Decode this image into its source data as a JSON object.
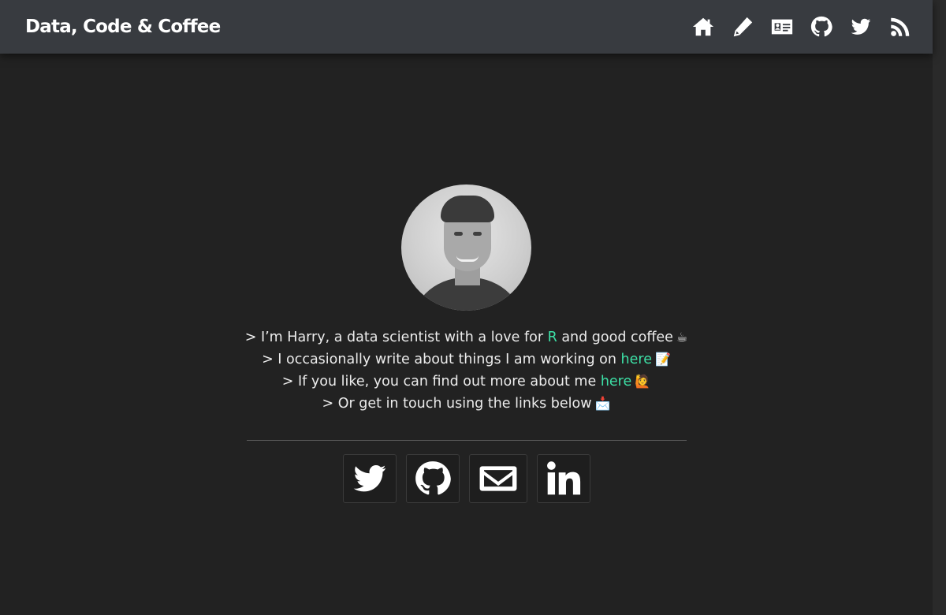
{
  "navbar": {
    "brand": "Data, Code & Coffee",
    "icons": [
      "home-icon",
      "pencil-icon",
      "id-card-icon",
      "github-icon",
      "twitter-icon",
      "rss-icon"
    ]
  },
  "bio": {
    "line1_pre": "> I’m Harry, a data scientist with a love for ",
    "line1_link": "R",
    "line1_post": " and good coffee",
    "line1_emoji": "☕",
    "line2_pre": "> I occasionally write about things I am working on ",
    "line2_link": "here",
    "line2_emoji": "📝",
    "line3_pre": "> If you like, you can find out more about me ",
    "line3_link": "here",
    "line3_emoji": "🙋",
    "line4_pre": "> Or get in touch using the links below",
    "line4_emoji": "📩"
  },
  "socials": [
    "twitter-icon",
    "github-icon",
    "envelope-icon",
    "linkedin-icon"
  ],
  "colors": {
    "background": "#222222",
    "navbar": "#383b40",
    "link": "#3de0a6",
    "text": "#ececec"
  }
}
